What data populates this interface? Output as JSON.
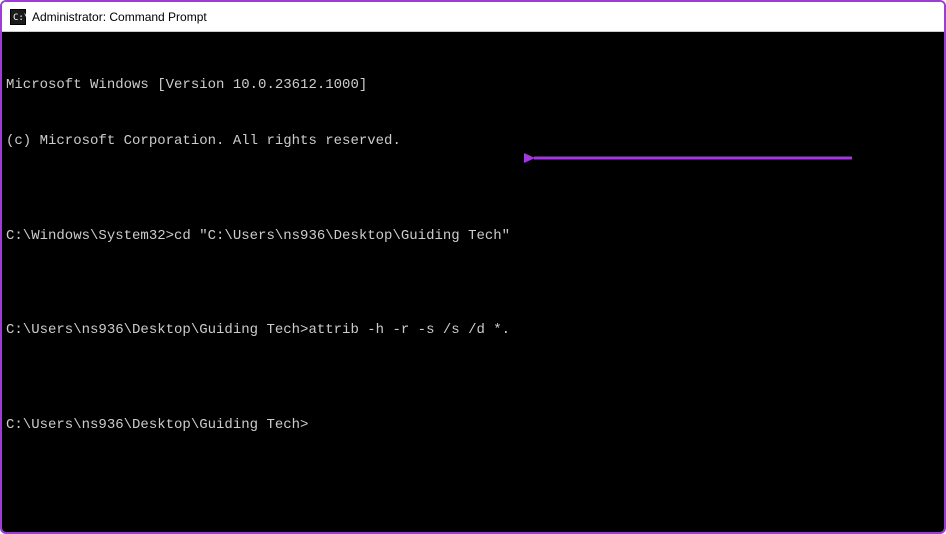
{
  "window": {
    "title": "Administrator: Command Prompt"
  },
  "terminal": {
    "lines": [
      "Microsoft Windows [Version 10.0.23612.1000]",
      "(c) Microsoft Corporation. All rights reserved.",
      "",
      "C:\\Windows\\System32>cd \"C:\\Users\\ns936\\Desktop\\Guiding Tech\"",
      "",
      "C:\\Users\\ns936\\Desktop\\Guiding Tech>attrib -h -r -s /s /d *.",
      "",
      "C:\\Users\\ns936\\Desktop\\Guiding Tech>"
    ]
  },
  "annotation": {
    "arrow_color": "#a239e0"
  }
}
